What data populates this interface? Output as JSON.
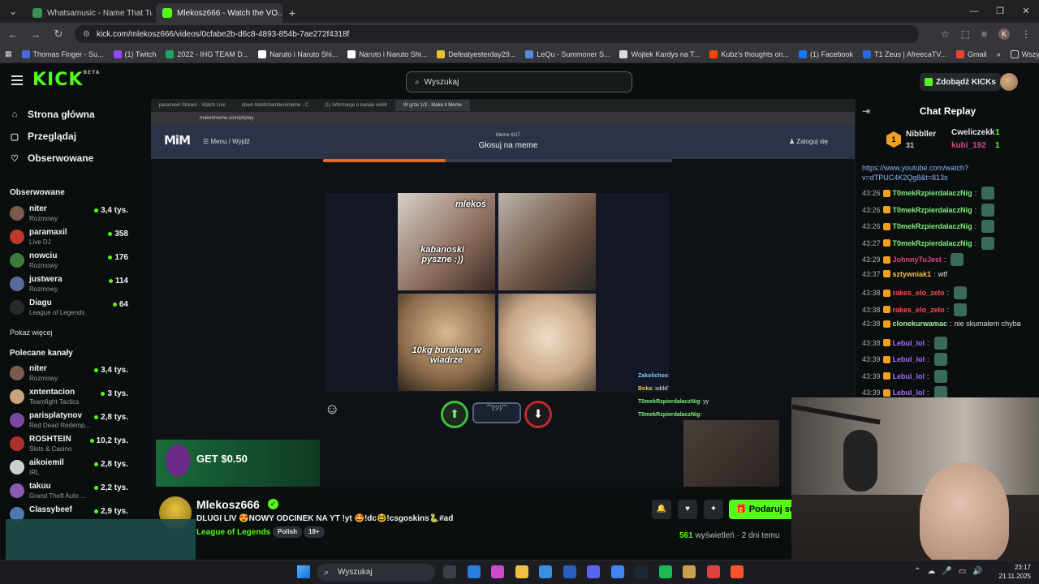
{
  "browser": {
    "tabs": [
      {
        "title": "Whatsamusic - Name That Tu...",
        "active": false,
        "color": "#3b8f5a"
      },
      {
        "title": "Mlekosz666 - Watch the VO...",
        "active": true,
        "color": "#53fc18"
      }
    ],
    "new_tab": "+",
    "url": "kick.com/mlekosz666/videos/0cfabe2b-d6c8-4893-854b-7ae272f4318f",
    "profile_initial": "K",
    "bookmarks": [
      {
        "label": "Thomas Finger - Su...",
        "color": "#4a6adf"
      },
      {
        "label": "(1) Twitch",
        "color": "#9146ff"
      },
      {
        "label": "2022 - IHG TEAM D...",
        "color": "#1fa463"
      },
      {
        "label": "Naruto i Naruto Shi...",
        "color": "#ffffff"
      },
      {
        "label": "Naruto i Naruto Shi...",
        "color": "#ffffff"
      },
      {
        "label": "Defeatyesterday29...",
        "color": "#e8c030"
      },
      {
        "label": "LeQu - Summoner S...",
        "color": "#5a8adf"
      },
      {
        "label": "Wojtek Kardys na T...",
        "color": "#dddddd"
      },
      {
        "label": "Kubz's thoughts on...",
        "color": "#ff4500"
      },
      {
        "label": "(1) Facebook",
        "color": "#1877f2"
      },
      {
        "label": "T1 Zeus | AfreecaTV...",
        "color": "#2a6adf"
      },
      {
        "label": "Gmail",
        "color": "#ea4335"
      }
    ],
    "all_bookmarks": "Wszystkie zakładki"
  },
  "header": {
    "logo": "KICK",
    "logo_badge": "BETA",
    "search_placeholder": "Wyszukaj",
    "get_kicks": "Zdobądź KICKs"
  },
  "sidebar": {
    "nav": [
      {
        "label": "Strona główna",
        "icon": "⌂"
      },
      {
        "label": "Przeglądaj",
        "icon": "▢"
      },
      {
        "label": "Obserwowane",
        "icon": "♡"
      }
    ],
    "followed_title": "Obserwowane",
    "followed": [
      {
        "name": "niter",
        "category": "Rozmowy",
        "viewers": "3,4 tys.",
        "color": "#7a5a4a"
      },
      {
        "name": "paramaxil",
        "category": "Live DJ",
        "viewers": "358",
        "color": "#c0392b"
      },
      {
        "name": "nowciu",
        "category": "Rozmowy",
        "viewers": "176",
        "color": "#3a7a3a"
      },
      {
        "name": "justwera",
        "category": "Rozmowy",
        "viewers": "114",
        "color": "#5a6a9a"
      },
      {
        "name": "Diagu",
        "category": "League of Legends",
        "viewers": "64",
        "color": "#2a2a2a"
      }
    ],
    "show_more": "Pokaż więcej",
    "recommended_title": "Polecane kanały",
    "recommended": [
      {
        "name": "niter",
        "category": "Rozmowy",
        "viewers": "3,4 tys.",
        "color": "#7a5a4a"
      },
      {
        "name": "xntentacion",
        "category": "Teamfight Tactics",
        "viewers": "3 tys.",
        "color": "#c8a27a"
      },
      {
        "name": "parisplatynov",
        "category": "Red Dead Redemp...",
        "viewers": "2,8 tys.",
        "color": "#7a4aa0"
      },
      {
        "name": "ROSHTEIN",
        "category": "Slots & Casino",
        "viewers": "10,2 tys.",
        "color": "#b03030"
      },
      {
        "name": "aikoiemil",
        "category": "IRL",
        "viewers": "2,8 tys.",
        "color": "#d0d0d0"
      },
      {
        "name": "takuu",
        "category": "Grand Theft Auto ...",
        "viewers": "2,2 tys.",
        "color": "#8a5ab0"
      },
      {
        "name": "Classybeef",
        "category": "",
        "viewers": "2,9 tys.",
        "color": "#4a7ab0"
      }
    ]
  },
  "video": {
    "inner_tabs": [
      "paramaxil Stream - Watch Live",
      "down bad4chamber#meme - C",
      "(1) Informacje o kanale wiol4",
      "W grze 1/3 - Make it Meme"
    ],
    "inner_url": "makeitmeme.com/pl/play",
    "mim_logo": "MiM",
    "mim_menu": "☰ Menu / Wyjdź",
    "mim_meme_counter": "Meme 6/17",
    "mim_title": "Głosuj na meme",
    "mim_login": "♟ Zaloguj się",
    "mim_progress": 0.35,
    "meme_captions": {
      "p1_top": "mlekoś",
      "p1_bottom": "kabanoski pyszne :))",
      "p3": "10kg burakuw w wiadrze"
    },
    "vote_mid": "⌒(ツ)⌒",
    "game_chat": [
      {
        "user": "Zakolichoo",
        "text": "",
        "color": "#7ec8f0"
      },
      {
        "user": "Boka",
        "text": "xddd'",
        "color": "#f0c040"
      },
      {
        "user": "T0mekRzpierdalaczNig",
        "text": "yy",
        "color": "#7ef07e"
      },
      {
        "user": "T0mekRzpierdalaczNig",
        "text": "",
        "color": "#7ef07e"
      }
    ],
    "banner_text": "GET $0.50"
  },
  "channel": {
    "name": "Mlekosz666",
    "title": "DLUGI LIV 😍NOWY ODCINEK NA YT !yt 🤩!dc🤓!csgoskins🐍#ad",
    "category": "League of Legends",
    "tags": [
      "Polish",
      "18+"
    ],
    "gift_label": "Podaruj su",
    "views_count": "561",
    "views_label": "wyświetleń",
    "ago": "2 dni temu"
  },
  "chat": {
    "title": "Chat Replay",
    "gifters": [
      {
        "rank": "1",
        "name": "Nibbller",
        "count": "31"
      },
      {
        "rank": "",
        "name": "Cweliczekk",
        "count": "1"
      },
      {
        "rank": "",
        "name": "kubi_192",
        "count": "1"
      }
    ],
    "link_line_1": "https://www.youtube.com/watch?",
    "link_line_2": "v=dTPUC4K2Qg8&t=813s",
    "messages": [
      {
        "time": "43:26",
        "user": "T0mekRzpierdalaczNig",
        "text": "",
        "color": "#7ef07e",
        "emote": true
      },
      {
        "time": "43:26",
        "user": "T0mekRzpierdalaczNig",
        "text": "",
        "color": "#7ef07e",
        "emote": true
      },
      {
        "time": "43:26",
        "user": "T0mekRzpierdalaczNig",
        "text": "",
        "color": "#7ef07e",
        "emote": true
      },
      {
        "time": "43:27",
        "user": "T0mekRzpierdalaczNig",
        "text": "",
        "color": "#7ef07e",
        "emote": true
      },
      {
        "time": "43:29",
        "user": "JohnnyTuJest",
        "text": "",
        "color": "#e0458a",
        "emote": true
      },
      {
        "time": "43:37",
        "user": "sztywniak1",
        "text": "wtf",
        "color": "#f0c040",
        "emote": false
      },
      {
        "time": "43:38",
        "user": "rakes_elo_zelo",
        "text": "",
        "color": "#ff4d4d",
        "emote": true
      },
      {
        "time": "43:38",
        "user": "rakes_elo_zelo",
        "text": "",
        "color": "#ff4d4d",
        "emote": true
      },
      {
        "time": "43:38",
        "user": "clonekurwamac",
        "text": "nie skumałem chyba",
        "color": "#9ef0a0",
        "emote": false
      },
      {
        "time": "43:38",
        "user": "Lebul_lol",
        "text": "",
        "color": "#a070ff",
        "emote": true
      },
      {
        "time": "43:39",
        "user": "Lebul_lol",
        "text": "",
        "color": "#a070ff",
        "emote": true
      },
      {
        "time": "43:39",
        "user": "Lebul_lol",
        "text": "",
        "color": "#a070ff",
        "emote": true
      },
      {
        "time": "43:39",
        "user": "Lebul_lol",
        "text": "",
        "color": "#a070ff",
        "emote": true
      }
    ]
  },
  "taskbar": {
    "search": "Wyszukaj",
    "time": "23:17",
    "date": "21.11.2025",
    "apps": [
      "#3a3f47",
      "#2a7de1",
      "#d04ad0",
      "#f0c040",
      "#3a8fe0",
      "#2a5fc0",
      "#5865f2",
      "#4285f4",
      "#1b2838",
      "#1db954",
      "#c8a050",
      "#e04040",
      "#fb542b"
    ]
  },
  "colors": {
    "accent": "#53fc18",
    "background": "#0b0e0f"
  }
}
